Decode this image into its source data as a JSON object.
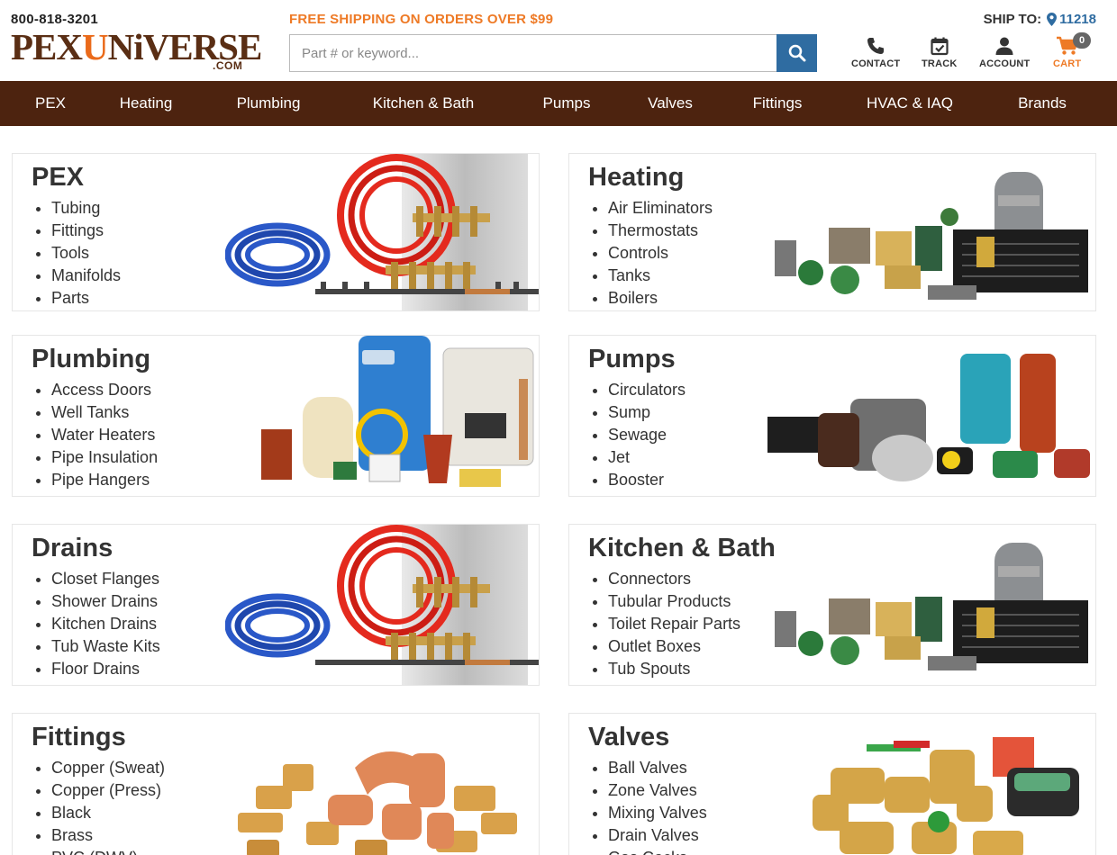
{
  "header": {
    "phone": "800-818-3201",
    "logo_text_1": "PEX",
    "logo_text_2": "U",
    "logo_text_3": "NiVERSE",
    "logo_sub": ".COM",
    "promo": "FREE SHIPPING ON ORDERS OVER $99",
    "search_placeholder": "Part # or keyword...",
    "ship_to_label": "SHIP TO:",
    "ship_zip": "11218",
    "contact_label": "CONTACT",
    "track_label": "TRACK",
    "account_label": "ACCOUNT",
    "cart_label": "CART",
    "cart_count": "0"
  },
  "nav": [
    "PEX",
    "Heating",
    "Plumbing",
    "Kitchen & Bath",
    "Pumps",
    "Valves",
    "Fittings",
    "HVAC & IAQ",
    "Brands"
  ],
  "colors": {
    "brown": "#4d230f",
    "orange": "#ee7a26",
    "blue": "#2f6ca1"
  },
  "cards": [
    {
      "title": "PEX",
      "items": [
        "Tubing",
        "Fittings",
        "Tools",
        "Manifolds",
        "Parts"
      ],
      "image": "pex-tubing-manifold"
    },
    {
      "title": "Heating",
      "items": [
        "Air Eliminators",
        "Thermostats",
        "Controls",
        "Tanks",
        "Boilers"
      ],
      "image": "heating-components"
    },
    {
      "title": "Plumbing",
      "items": [
        "Access Doors",
        "Well Tanks",
        "Water Heaters",
        "Pipe Insulation",
        "Pipe Hangers"
      ],
      "image": "plumbing-tanks-heaters"
    },
    {
      "title": "Pumps",
      "items": [
        "Circulators",
        "Sump",
        "Sewage",
        "Jet",
        "Booster"
      ],
      "image": "assorted-pumps"
    },
    {
      "title": "Drains",
      "items": [
        "Closet Flanges",
        "Shower Drains",
        "Kitchen Drains",
        "Tub Waste Kits",
        "Floor Drains"
      ],
      "image": "pex-tubing-manifold"
    },
    {
      "title": "Kitchen & Bath",
      "items": [
        "Connectors",
        "Tubular Products",
        "Toilet Repair Parts",
        "Outlet Boxes",
        "Tub Spouts"
      ],
      "image": "heating-components"
    },
    {
      "title": "Fittings",
      "items": [
        "Copper (Sweat)",
        "Copper (Press)",
        "Black",
        "Brass",
        "PVC (DWV)"
      ],
      "image": "copper-brass-fittings"
    },
    {
      "title": "Valves",
      "items": [
        "Ball Valves",
        "Zone Valves",
        "Mixing Valves",
        "Drain Valves",
        "Gas Cocks"
      ],
      "image": "assorted-valves"
    }
  ]
}
